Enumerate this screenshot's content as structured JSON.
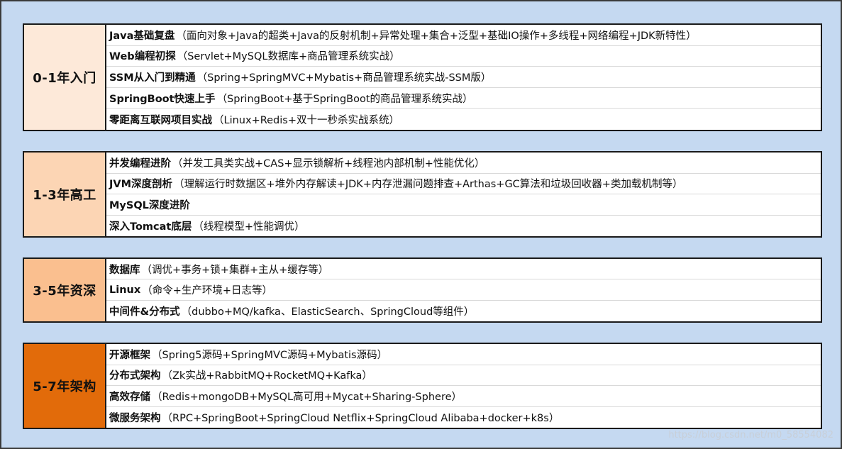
{
  "colors": {
    "background": "#c5d9f1",
    "stage_0_1": "#fde9d9",
    "stage_1_3": "#fcd5b4",
    "stage_3_5": "#fabf8f",
    "stage_5_7": "#e26b0a"
  },
  "blocks": [
    {
      "stage": "0-1年入门",
      "items": [
        {
          "title": "Java基础复盘",
          "desc": "（面向对象+Java的超类+Java的反射机制+异常处理+集合+泛型+基础IO操作+多线程+网络编程+JDK新特性）"
        },
        {
          "title": "Web编程初探",
          "desc": "（Servlet+MySQL数据库+商品管理系统实战）"
        },
        {
          "title": "SSM从入门到精通",
          "desc": "（Spring+SpringMVC+Mybatis+商品管理系统实战-SSM版）"
        },
        {
          "title": "SpringBoot快速上手",
          "desc": "（SpringBoot+基于SpringBoot的商品管理系统实战）"
        },
        {
          "title": "零距离互联网项目实战",
          "desc": "（Linux+Redis+双十一秒杀实战系统）"
        }
      ]
    },
    {
      "stage": "1-3年高工",
      "items": [
        {
          "title": "并发编程进阶",
          "desc": "（并发工具类实战+CAS+显示锁解析+线程池内部机制+性能优化）"
        },
        {
          "title": "JVM深度剖析",
          "desc": "（理解运行时数据区+堆外内存解读+JDK+内存泄漏问题排查+Arthas+GC算法和垃圾回收器+类加载机制等）"
        },
        {
          "title": "MySQL深度进阶",
          "desc": ""
        },
        {
          "title": "深入Tomcat底层",
          "desc": "（线程模型+性能调优）"
        }
      ]
    },
    {
      "stage": "3-5年资深",
      "items": [
        {
          "title": "数据库",
          "desc": "（调优+事务+锁+集群+主从+缓存等）"
        },
        {
          "title": "Linux",
          "desc": "（命令+生产环境+日志等）"
        },
        {
          "title": "中间件&分布式",
          "desc": "（dubbo+MQ/kafka、ElasticSearch、SpringCloud等组件）"
        }
      ]
    },
    {
      "stage": "5-7年架构",
      "items": [
        {
          "title": "开源框架",
          "desc": "（Spring5源码+SpringMVC源码+Mybatis源码）"
        },
        {
          "title": "分布式架构",
          "desc": "（Zk实战+RabbitMQ+RocketMQ+Kafka）"
        },
        {
          "title": "高效存储",
          "desc": "（Redis+mongoDB+MySQL高可用+Mycat+Sharing-Sphere）"
        },
        {
          "title": "微服务架构",
          "desc": "（RPC+SpringBoot+SpringCloud Netflix+SpringCloud Alibaba+docker+k8s）"
        }
      ]
    }
  ],
  "watermark": "https://blog.csdn.net/m0_58554082"
}
